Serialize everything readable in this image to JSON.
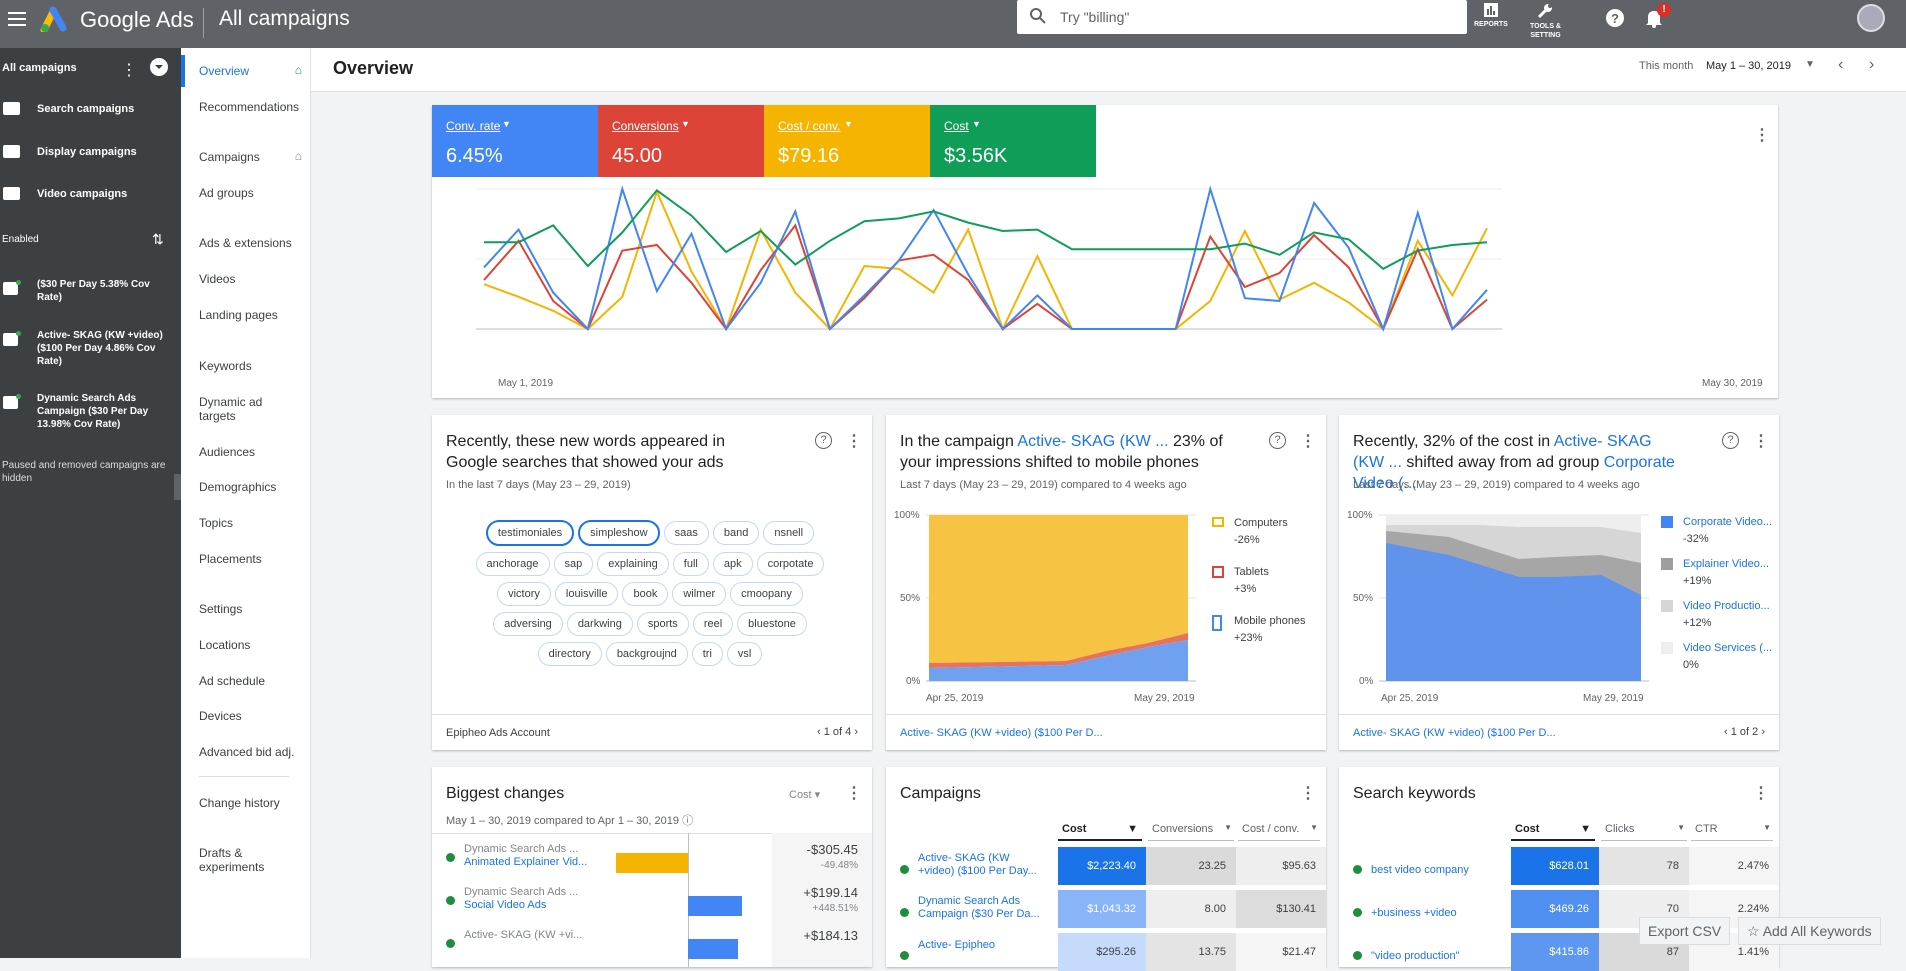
{
  "app": {
    "name": "Google Ads",
    "page_title": "All campaigns",
    "search_placeholder": "Try \"billing\"",
    "reports": "REPORTS",
    "tools1": "TOOLS &",
    "tools2": "SETTING",
    "badge": "!"
  },
  "left_panel": {
    "header": "All campaigns",
    "types": [
      "Search campaigns",
      "Display campaigns",
      "Video campaigns"
    ],
    "enabled": "Enabled",
    "campaigns": [
      "($30 Per Day 5.38% Cov Rate)",
      "Active- SKAG (KW +video) ($100 Per Day 4.86% Cov Rate)",
      "Dynamic Search Ads Campaign ($30 Per Day 13.98% Cov Rate)"
    ],
    "paused_note": "Paused and removed campaigns are hidden"
  },
  "nav": {
    "overview": "Overview",
    "recommendations": "Recommendations",
    "campaigns": "Campaigns",
    "ad_groups": "Ad groups",
    "ads_ext": "Ads & extensions",
    "videos": "Videos",
    "landing": "Landing pages",
    "keywords": "Keywords",
    "dynamic1": "Dynamic ad",
    "dynamic2": "targets",
    "audiences": "Audiences",
    "demographics": "Demographics",
    "topics": "Topics",
    "placements": "Placements",
    "settings": "Settings",
    "locations": "Locations",
    "ad_schedule": "Ad schedule",
    "devices": "Devices",
    "adv_bid": "Advanced bid adj.",
    "change_history": "Change history",
    "drafts1": "Drafts &",
    "drafts2": "experiments"
  },
  "header": {
    "title": "Overview",
    "this_month": "This month",
    "date_range": "May 1 – 30, 2019"
  },
  "metrics": [
    {
      "label": "Conv. rate",
      "value": "6.45%",
      "color": "#4285f4"
    },
    {
      "label": "Conversions",
      "value": "45.00",
      "color": "#db4437"
    },
    {
      "label": "Cost / conv.",
      "value": "$79.16",
      "color": "#f4b400"
    },
    {
      "label": "Cost",
      "value": "$3.56K",
      "color": "#0f9d58"
    }
  ],
  "chart_data": {
    "type": "line",
    "x_start": "May 1, 2019",
    "x_end": "May 30, 2019",
    "x": [
      1,
      2,
      3,
      4,
      5,
      6,
      7,
      8,
      9,
      10,
      11,
      12,
      13,
      14,
      15,
      16,
      17,
      18,
      19,
      20,
      21,
      22,
      23,
      24,
      25,
      26,
      27,
      28,
      29,
      30
    ],
    "series": [
      {
        "name": "Conv. rate",
        "color": "#4285f4",
        "values": [
          0.44,
          0.71,
          0.26,
          0,
          1,
          0.27,
          0.68,
          0,
          0.33,
          0.84,
          0,
          0.24,
          0.49,
          0.85,
          0.39,
          0,
          0.24,
          0,
          0,
          0,
          0,
          1,
          0.22,
          0.2,
          0.9,
          0.58,
          0,
          0.83,
          0,
          0.28
        ]
      },
      {
        "name": "Conversions",
        "color": "#db4437",
        "values": [
          0.35,
          0.63,
          0.2,
          0,
          0.56,
          0.6,
          0.33,
          0,
          0.42,
          0.74,
          0,
          0.22,
          0.49,
          0.53,
          0.35,
          0,
          0.18,
          0,
          0,
          0,
          0,
          0.66,
          0.3,
          0.4,
          0.67,
          0.44,
          0,
          0.57,
          0,
          0.21
        ]
      },
      {
        "name": "Cost / conv.",
        "color": "#f4b400",
        "values": [
          0.32,
          0.23,
          0.13,
          0,
          0.23,
          0.98,
          0.41,
          0,
          0.71,
          0.26,
          0,
          0.45,
          0.43,
          0.26,
          0.71,
          0,
          0.52,
          0,
          0,
          0,
          0,
          0.2,
          0.7,
          0.21,
          0.33,
          0.19,
          0,
          0.63,
          0.24,
          0.72
        ]
      },
      {
        "name": "Cost",
        "color": "#0f9d58",
        "values": [
          0.62,
          0.62,
          0.74,
          0.45,
          0.69,
          0.99,
          0.81,
          0.55,
          0.7,
          0.46,
          0.63,
          0.77,
          0.79,
          0.84,
          0.76,
          0.7,
          0.71,
          0.57,
          0.57,
          0.57,
          0.57,
          0.57,
          0.61,
          0.53,
          0.69,
          0.64,
          0.43,
          0.56,
          0.6,
          0.62
        ]
      }
    ]
  },
  "words_card": {
    "title": "Recently, these new words appeared in Google searches that showed your ads",
    "sub": "In the last 7 days (May 23 – 29, 2019)",
    "words": [
      "testimoniales",
      "simpleshow",
      "saas",
      "band",
      "nsnell",
      "anchorage",
      "sap",
      "explaining",
      "full",
      "apk",
      "corpotate",
      "victory",
      "louisville",
      "book",
      "wilmer",
      "cmoopany",
      "adversing",
      "darkwing",
      "sports",
      "reel",
      "bluestone",
      "directory",
      "backgroujnd",
      "tri",
      "vsl"
    ],
    "footer": "Epipheo Ads Account",
    "page": "1 of 4"
  },
  "device_card": {
    "t1": "In the campaign ",
    "tlink": "Active- SKAG (KW ...",
    "t2": " 23% of your impressions shifted to mobile phones",
    "sub": "Last 7 days (May 23 – 29, 2019) compared to 4 weeks ago",
    "legend": [
      {
        "name": "Computers",
        "pct": "-26%",
        "color": "#f4b400"
      },
      {
        "name": "Tablets",
        "pct": "+3%",
        "color": "#db4437"
      },
      {
        "name": "Mobile phones",
        "pct": "+23%",
        "color": "#4285f4"
      }
    ],
    "y100": "100%",
    "y50": "50%",
    "y0": "0%",
    "xs": "Apr 25, 2019",
    "xe": "May 29, 2019",
    "footer": "Active- SKAG (KW +video) ($100 Per D..."
  },
  "cost_card": {
    "t1": "Recently, 32% of the cost in ",
    "tlink1": "Active- SKAG (KW ...",
    "t2": " shifted away from ad group ",
    "tlink2": "Corporate Video (...",
    "sub": "Last 7 days (May 23 – 29, 2019) compared to 4 weeks ago",
    "legend": [
      {
        "name": "Corporate Video...",
        "pct": "-32%",
        "color": "#4285f4"
      },
      {
        "name": "Explainer Video...",
        "pct": "+19%",
        "color": "#9e9e9e"
      },
      {
        "name": "Video Productio...",
        "pct": "+12%",
        "color": "#d6d6d6"
      },
      {
        "name": "Video Services (...",
        "pct": "0%",
        "color": "#eeeeee"
      }
    ],
    "y100": "100%",
    "y50": "50%",
    "y0": "0%",
    "xs": "Apr 25, 2019",
    "xe": "May 29, 2019",
    "footer": "Active- SKAG (KW +video) ($100 Per D...",
    "page": "1 of 2"
  },
  "changes_card": {
    "title": "Biggest changes",
    "sub": "May 1 – 30, 2019 compared to Apr 1 – 30, 2019",
    "metric": "Cost",
    "rows": [
      {
        "camp": "Dynamic Search Ads ...",
        "adg": "Animated Explainer Vid...",
        "val": "-$305.45",
        "pct": "-49.48%"
      },
      {
        "camp": "Dynamic Search Ads ...",
        "adg": "Social Video Ads",
        "val": "+$199.14",
        "pct": "+448.51%"
      },
      {
        "camp": "Active- SKAG (KW +vi...",
        "adg": "",
        "val": "+$184.13",
        "pct": ""
      }
    ]
  },
  "campaigns_card": {
    "title": "Campaigns",
    "cols": [
      "Cost",
      "Conversions",
      "Cost / conv."
    ],
    "rows": [
      {
        "name1": "Active- SKAG (KW",
        "name2": "+video) ($100 Per Day...",
        "cost": "$2,223.40",
        "conv": "23.25",
        "cpc": "$95.63"
      },
      {
        "name1": "Dynamic Search Ads",
        "name2": "Campaign ($30 Per Da...",
        "cost": "$1,043.32",
        "conv": "8.00",
        "cpc": "$130.41"
      },
      {
        "name1": "Active- Epipheo",
        "name2": "",
        "cost": "$295.26",
        "conv": "13.75",
        "cpc": "$21.47"
      }
    ]
  },
  "keywords_card": {
    "title": "Search keywords",
    "cols": [
      "Cost",
      "Clicks",
      "CTR"
    ],
    "rows": [
      {
        "kw": "best video company",
        "cost": "$628.01",
        "clicks": "78",
        "ctr": "2.47%"
      },
      {
        "kw": "+business +video",
        "cost": "$469.26",
        "clicks": "70",
        "ctr": "2.24%"
      },
      {
        "kw": "\"video production\"",
        "cost": "$415.86",
        "clicks": "87",
        "ctr": "1.41%"
      }
    ],
    "export": "Export CSV",
    "add": "Add All Keywords"
  }
}
